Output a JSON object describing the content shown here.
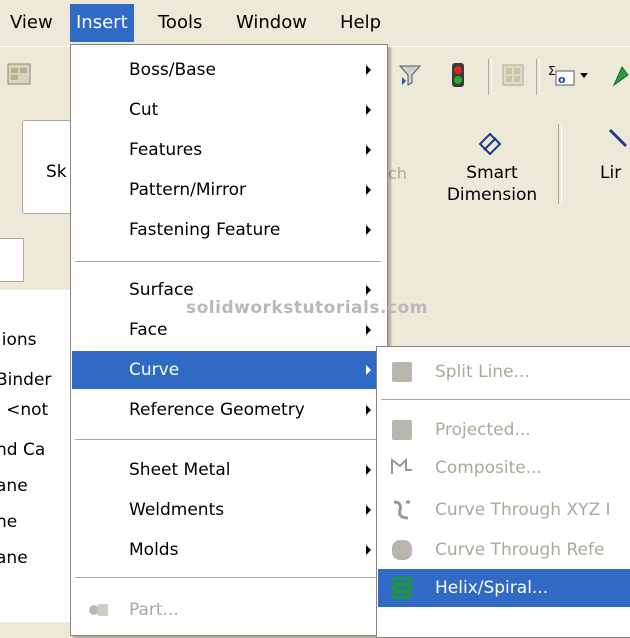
{
  "menubar": {
    "items": [
      {
        "label": "View"
      },
      {
        "label": "Insert"
      },
      {
        "label": "Tools"
      },
      {
        "label": "Window"
      },
      {
        "label": "Help"
      }
    ]
  },
  "command_manager": {
    "sketch_label": "Sk",
    "faded_label": "ch",
    "smart_dimension_label_1": "Smart",
    "smart_dimension_label_2": "Dimension",
    "line_label": "Lir"
  },
  "feature_tree": {
    "items": [
      ":ions",
      "Binder",
      "l <not",
      "nd Ca",
      "ane",
      "ne",
      "ane"
    ]
  },
  "watermark": "solidworkstutorials.com",
  "insert_menu": {
    "items": [
      {
        "label": "Boss/Base"
      },
      {
        "label": "Cut"
      },
      {
        "label": "Features"
      },
      {
        "label": "Pattern/Mirror"
      },
      {
        "label": "Fastening Feature"
      },
      {
        "label": "Surface"
      },
      {
        "label": "Face"
      },
      {
        "label": "Curve"
      },
      {
        "label": "Reference Geometry"
      },
      {
        "label": "Sheet Metal"
      },
      {
        "label": "Weldments"
      },
      {
        "label": "Molds"
      },
      {
        "label": "Part..."
      }
    ]
  },
  "curve_submenu": {
    "items": [
      {
        "label": "Split Line..."
      },
      {
        "label": "Projected..."
      },
      {
        "label": "Composite..."
      },
      {
        "label": "Curve Through XYZ I"
      },
      {
        "label": "Curve Through Refe"
      },
      {
        "label": "Helix/Spiral..."
      }
    ]
  },
  "colors": {
    "highlight": "#316ac5",
    "menu_bg": "#ffffff",
    "chrome": "#ece9d8",
    "disabled_text": "#aca899",
    "helix_icon": "#1a9a3a"
  }
}
